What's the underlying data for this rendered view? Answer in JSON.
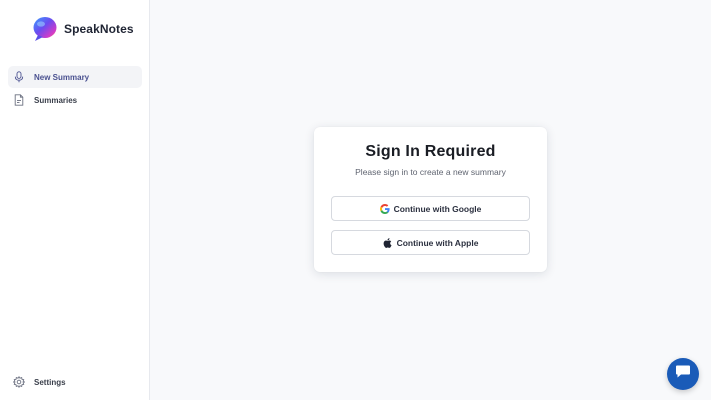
{
  "app": {
    "name": "SpeakNotes"
  },
  "sidebar": {
    "items": [
      {
        "label": "New Summary",
        "icon": "microphone-icon",
        "active": true
      },
      {
        "label": "Summaries",
        "icon": "document-icon",
        "active": false
      }
    ],
    "footer": {
      "label": "Settings",
      "icon": "gear-icon"
    }
  },
  "signin": {
    "title": "Sign In Required",
    "subtitle": "Please sign in to create a new summary",
    "google_label": "Continue with Google",
    "apple_label": "Continue with Apple"
  },
  "chat": {
    "icon": "chat-bubble-icon"
  },
  "colors": {
    "accent": "#4a5190",
    "fab": "#1a5bb8",
    "background": "#f8f9fb"
  }
}
